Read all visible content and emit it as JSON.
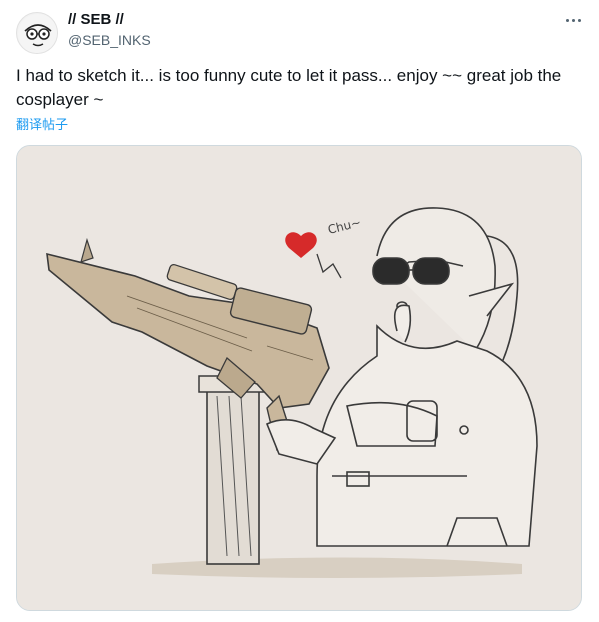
{
  "author": {
    "display_name": "// SEB //",
    "handle": "@SEB_INKS",
    "avatar_icon": "cartoon-face-avatar"
  },
  "more_icon": "more-horizontal-icon",
  "tweet": {
    "text": "I had to sketch it... is too funny cute to let it pass... enjoy ~~ great job the cosplayer ~",
    "translate_label": "翻译帖子"
  },
  "media": {
    "type": "illustration",
    "handwritten_text": "Chu~",
    "colors": {
      "paper": "#ebe6e1",
      "gun": "#c9b79c",
      "ink": "#3a3a3a",
      "heart": "#d62a2a",
      "ground": "#d8cfc2"
    }
  }
}
